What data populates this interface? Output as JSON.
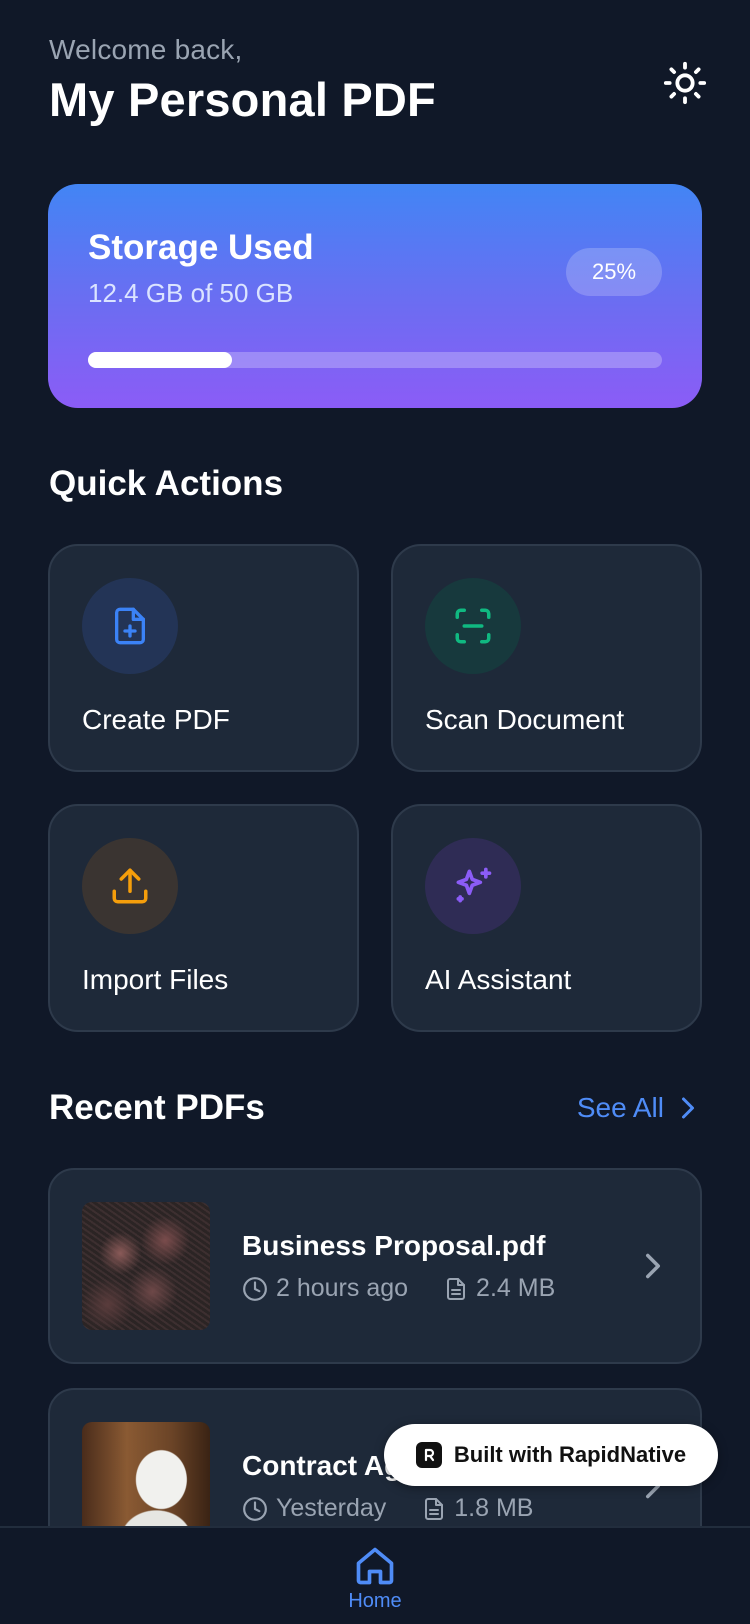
{
  "header": {
    "welcome": "Welcome back,",
    "title": "My Personal PDF",
    "theme_icon": "sun-icon"
  },
  "storage": {
    "title": "Storage Used",
    "subtitle": "12.4 GB of 50 GB",
    "percent_label": "25%",
    "progress": 0.25
  },
  "quick_actions": {
    "title": "Quick Actions",
    "items": [
      {
        "label": "Create PDF",
        "icon": "file-plus-icon",
        "color": "#3b82f6"
      },
      {
        "label": "Scan Document",
        "icon": "scan-icon",
        "color": "#10b981"
      },
      {
        "label": "Import Files",
        "icon": "upload-icon",
        "color": "#f59e0b"
      },
      {
        "label": "AI Assistant",
        "icon": "sparkles-icon",
        "color": "#8b5cf6"
      }
    ]
  },
  "recent": {
    "title": "Recent PDFs",
    "see_all": "See All",
    "items": [
      {
        "name": "Business Proposal.pdf",
        "time": "2 hours ago",
        "size": "2.4 MB"
      },
      {
        "name": "Contract Ag",
        "time": "Yesterday",
        "size": "1.8 MB"
      }
    ]
  },
  "badge": {
    "label": "Built with RapidNative"
  },
  "tabbar": {
    "home": "Home"
  },
  "colors": {
    "background": "#101828",
    "card": "#1e2939",
    "accent": "#4f8cf7"
  }
}
